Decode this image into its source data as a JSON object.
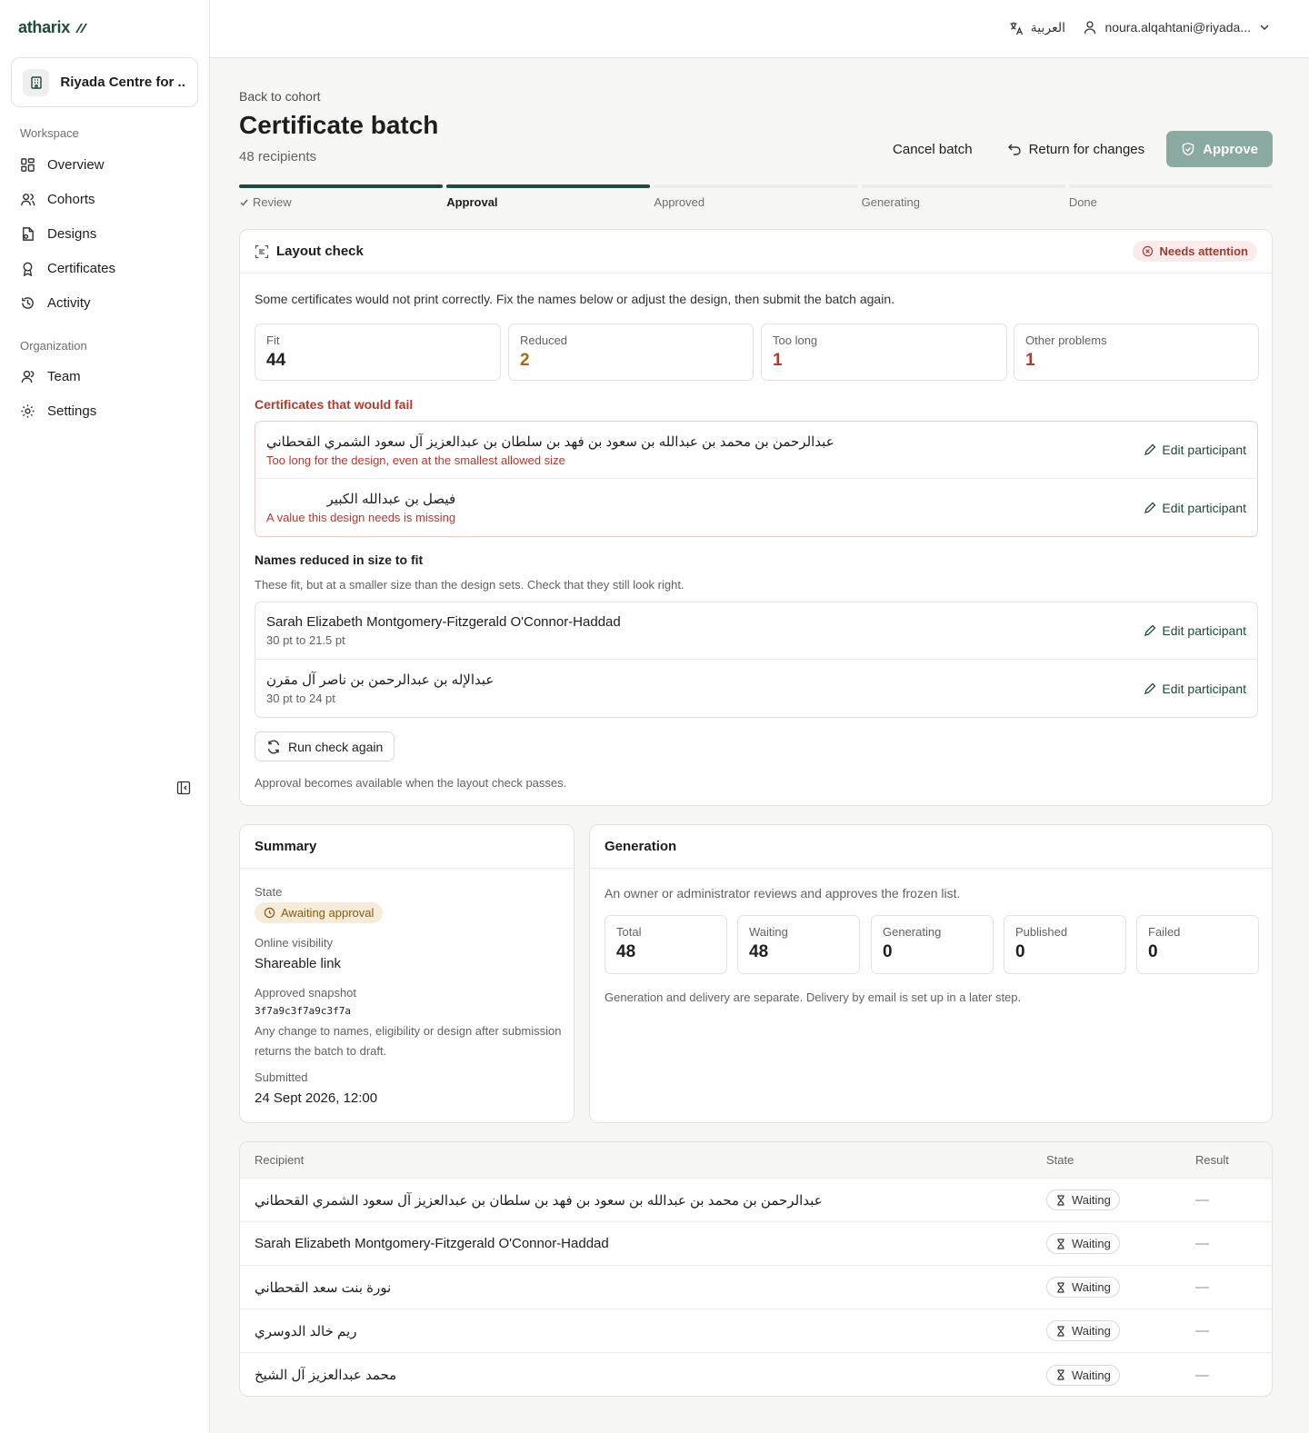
{
  "app": {
    "logo": "atharix"
  },
  "sidebar": {
    "org_name": "Riyada Centre for ...",
    "workspace_heading": "Workspace",
    "workspace_items": [
      {
        "label": "Overview",
        "icon": "grid-icon"
      },
      {
        "label": "Cohorts",
        "icon": "users-icon"
      },
      {
        "label": "Designs",
        "icon": "file-design-icon"
      },
      {
        "label": "Certificates",
        "icon": "award-icon"
      },
      {
        "label": "Activity",
        "icon": "history-icon"
      }
    ],
    "organization_heading": "Organization",
    "organization_items": [
      {
        "label": "Team",
        "icon": "user-icon"
      },
      {
        "label": "Settings",
        "icon": "gear-icon"
      }
    ]
  },
  "topbar": {
    "language": "العربية",
    "user": "noura.alqahtani@riyada..."
  },
  "page": {
    "back": "Back to cohort",
    "title": "Certificate batch",
    "subtitle": "48 recipients",
    "actions": {
      "cancel": "Cancel batch",
      "return": "Return for changes",
      "approve": "Approve"
    },
    "steps": [
      {
        "label": "Review",
        "state": "done"
      },
      {
        "label": "Approval",
        "state": "active"
      },
      {
        "label": "Approved",
        "state": "todo"
      },
      {
        "label": "Generating",
        "state": "todo"
      },
      {
        "label": "Done",
        "state": "todo"
      }
    ]
  },
  "layout_check": {
    "title": "Layout check",
    "status": "Needs attention",
    "intro": "Some certificates would not print correctly. Fix the names below or adjust the design, then submit the batch again.",
    "stats": [
      {
        "label": "Fit",
        "value": "44",
        "color": "#1c1f1e"
      },
      {
        "label": "Reduced",
        "value": "2",
        "color": "#a86a10"
      },
      {
        "label": "Too long",
        "value": "1",
        "color": "#b33a2e"
      },
      {
        "label": "Other problems",
        "value": "1",
        "color": "#b33a2e"
      }
    ],
    "fail_title": "Certificates that would fail",
    "fail_rows": [
      {
        "name": "عبدالرحمن بن محمد بن عبدالله بن سعود بن فهد بن سلطان بن عبدالعزيز آل سعود الشمري القحطاني",
        "reason": "Too long for the design, even at the smallest allowed size",
        "action": "Edit participant"
      },
      {
        "name": "فيصل بن عبدالله الكبير",
        "reason": "A value this design needs is missing",
        "action": "Edit participant"
      }
    ],
    "reduced_title": "Names reduced in size to fit",
    "reduced_note": "These fit, but at a smaller size than the design sets. Check that they still look right.",
    "reduced_rows": [
      {
        "name": "Sarah Elizabeth Montgomery-Fitzgerald O'Connor-Haddad",
        "detail": "30 pt to 21.5 pt",
        "action": "Edit participant"
      },
      {
        "name": "عبدالإله بن عبدالرحمن بن ناصر آل مقرن",
        "detail": "30 pt to 24 pt",
        "action": "Edit participant"
      }
    ],
    "run_again": "Run check again",
    "footer": "Approval becomes available when the layout check passes."
  },
  "summary": {
    "title": "Summary",
    "state_label": "State",
    "state_value": "Awaiting approval",
    "visibility_label": "Online visibility",
    "visibility_value": "Shareable link",
    "snapshot_label": "Approved snapshot",
    "snapshot_value": "3f7a9c3f7a9c3f7a",
    "snapshot_note_1": "Any change to names, eligibility or design after submission",
    "snapshot_note_2": "returns the batch to draft.",
    "submitted_label": "Submitted",
    "submitted_value": "24 Sept 2026, 12:00"
  },
  "generation": {
    "title": "Generation",
    "intro": "An owner or administrator reviews and approves the frozen list.",
    "stats": [
      {
        "label": "Total",
        "value": "48"
      },
      {
        "label": "Waiting",
        "value": "48"
      },
      {
        "label": "Generating",
        "value": "0"
      },
      {
        "label": "Published",
        "value": "0"
      },
      {
        "label": "Failed",
        "value": "0"
      }
    ],
    "note": "Generation and delivery are separate. Delivery by email is set up in a later step."
  },
  "recipients": {
    "headers": {
      "recipient": "Recipient",
      "state": "State",
      "result": "Result"
    },
    "rows": [
      {
        "name": "عبدالرحمن بن محمد بن عبدالله بن سعود بن فهد بن سلطان بن عبدالعزيز آل سعود الشمري القحطاني",
        "state": "Waiting",
        "result": "—"
      },
      {
        "name": "Sarah Elizabeth Montgomery-Fitzgerald O'Connor-Haddad",
        "state": "Waiting",
        "result": "—"
      },
      {
        "name": "نورة بنت سعد القحطاني",
        "state": "Waiting",
        "result": "—"
      },
      {
        "name": "ريم خالد الدوسري",
        "state": "Waiting",
        "result": "—"
      },
      {
        "name": "محمد عبدالعزيز آل الشيخ",
        "state": "Waiting",
        "result": "—"
      }
    ]
  }
}
